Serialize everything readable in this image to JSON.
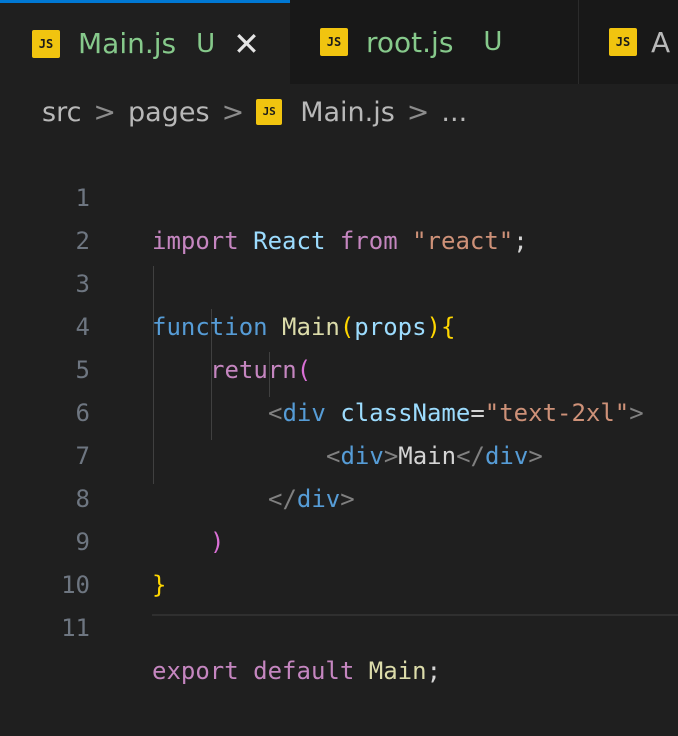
{
  "tabs": [
    {
      "icon": "JS",
      "label": "Main.js",
      "status": "U",
      "close": "✕"
    },
    {
      "icon": "JS",
      "label": "root.js",
      "status": "U"
    },
    {
      "icon": "JS",
      "label": "A"
    }
  ],
  "breadcrumb": {
    "items": [
      "src",
      "pages"
    ],
    "file_icon": "JS",
    "file": "Main.js",
    "ellipsis": "...",
    "separator": ">"
  },
  "code": {
    "line_numbers": [
      "1",
      "2",
      "3",
      "4",
      "5",
      "6",
      "7",
      "8",
      "9",
      "10",
      "11"
    ],
    "l1": {
      "kw": "import",
      "name": "React",
      "from": "from",
      "str": "\"react\"",
      "semi": ";"
    },
    "l3": {
      "kw": "function",
      "name": "Main",
      "open": "(",
      "param": "props",
      "close": ")",
      "brace": "{"
    },
    "l4": {
      "kw": "return",
      "paren": "("
    },
    "l5": {
      "lt": "<",
      "tag": "div",
      "attr": "className",
      "eq": "=",
      "val": "\"text-2xl\"",
      "gt": ">"
    },
    "l6": {
      "lt": "<",
      "tag": "div",
      "gt": ">",
      "text": "Main",
      "clt": "</",
      "ctag": "div",
      "cgt": ">"
    },
    "l7": {
      "clt": "</",
      "ctag": "div",
      "cgt": ">"
    },
    "l8": {
      "paren": ")"
    },
    "l9": {
      "brace": "}"
    },
    "l11": {
      "kw1": "export",
      "kw2": "default",
      "name": "Main",
      "semi": ";"
    }
  },
  "colors": {
    "accent": "#0078d4",
    "js_badge": "#f1c40f",
    "untracked": "#86c98b"
  }
}
